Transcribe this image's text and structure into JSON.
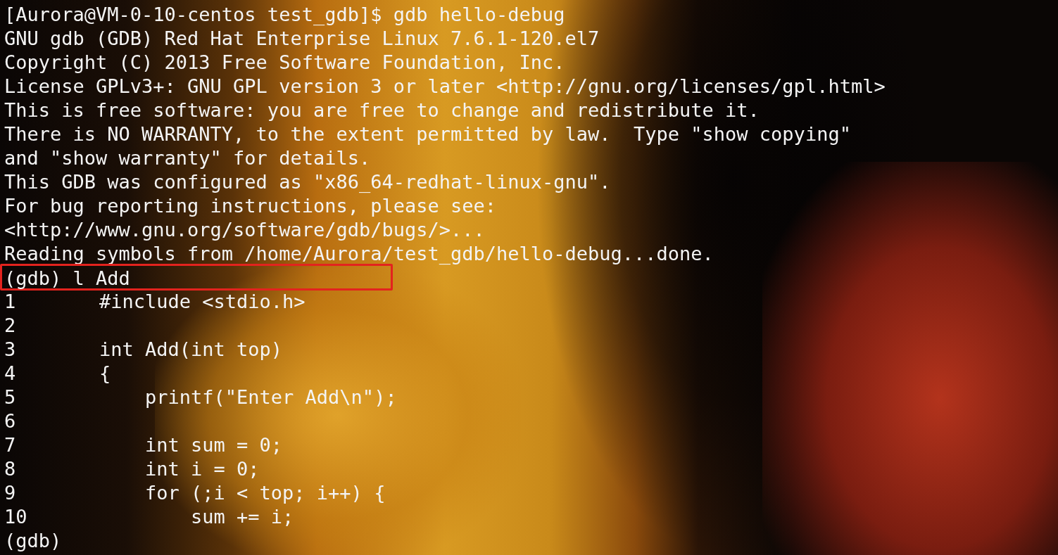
{
  "terminal": {
    "lines": [
      {
        "kind": "output",
        "text": "[Aurora@VM-0-10-centos test_gdb]$ gdb hello-debug",
        "highlighted": false
      },
      {
        "kind": "output",
        "text": "GNU gdb (GDB) Red Hat Enterprise Linux 7.6.1-120.el7",
        "highlighted": false
      },
      {
        "kind": "output",
        "text": "Copyright (C) 2013 Free Software Foundation, Inc.",
        "highlighted": false
      },
      {
        "kind": "output",
        "text": "License GPLv3+: GNU GPL version 3 or later <http://gnu.org/licenses/gpl.html>",
        "highlighted": false
      },
      {
        "kind": "output",
        "text": "This is free software: you are free to change and redistribute it.",
        "highlighted": false
      },
      {
        "kind": "output",
        "text": "There is NO WARRANTY, to the extent permitted by law.  Type \"show copying\"",
        "highlighted": false
      },
      {
        "kind": "output",
        "text": "and \"show warranty\" for details.",
        "highlighted": false
      },
      {
        "kind": "output",
        "text": "This GDB was configured as \"x86_64-redhat-linux-gnu\".",
        "highlighted": false
      },
      {
        "kind": "output",
        "text": "For bug reporting instructions, please see:",
        "highlighted": false
      },
      {
        "kind": "output",
        "text": "<http://www.gnu.org/software/gdb/bugs/>...",
        "highlighted": false
      },
      {
        "kind": "output",
        "text": "Reading symbols from /home/Aurora/test_gdb/hello-debug...done.",
        "highlighted": false
      },
      {
        "kind": "output",
        "text": "(gdb) l Add",
        "highlighted": true
      },
      {
        "kind": "code",
        "number": "1",
        "code": "#include <stdio.h>"
      },
      {
        "kind": "code",
        "number": "2"
      },
      {
        "kind": "code",
        "number": "3",
        "code": "int Add(int top)"
      },
      {
        "kind": "code",
        "number": "4",
        "code": "{"
      },
      {
        "kind": "code",
        "number": "5",
        "code": "    printf(\"Enter Add\\n\");"
      },
      {
        "kind": "code",
        "number": "6"
      },
      {
        "kind": "code",
        "number": "7",
        "code": "    int sum = 0;"
      },
      {
        "kind": "code",
        "number": "8",
        "code": "    int i = 0;"
      },
      {
        "kind": "code",
        "number": "9",
        "code": "    for (;i < top; i++) {"
      },
      {
        "kind": "code",
        "number": "10",
        "code": "        sum += i;"
      },
      {
        "kind": "output",
        "text": "(gdb)",
        "highlighted": false
      }
    ]
  }
}
